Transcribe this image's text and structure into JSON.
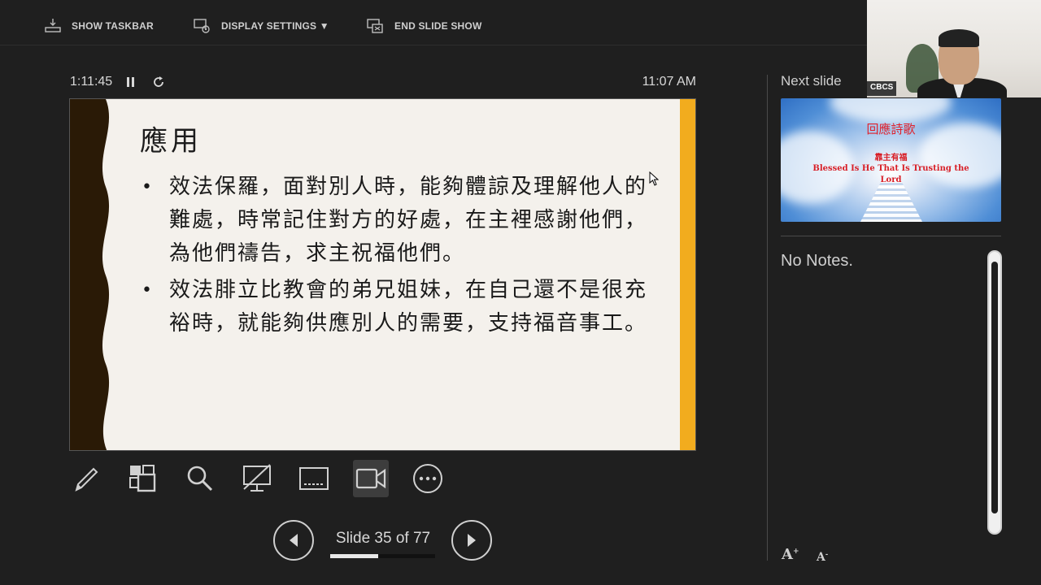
{
  "toolbar": {
    "show_taskbar": "SHOW TASKBAR",
    "display_settings": "DISPLAY SETTINGS ▼",
    "end_slide_show": "END SLIDE SHOW"
  },
  "timer": {
    "elapsed": "1:11:45",
    "clock": "11:07 AM"
  },
  "slide": {
    "title": "應用",
    "bullets": [
      "效法保羅，面對別人時，能夠體諒及理解他人的難處，時常記住對方的好處，在主裡感謝他們，為他們禱告，求主祝福他們。",
      "效法腓立比教會的弟兄姐妹，在自己還不是很充裕時，就能夠供應別人的需要，支持福音事工。"
    ],
    "accent_color": "#f2ac1e",
    "border_color": "#2a1a06"
  },
  "tools": [
    "pen-icon",
    "see-all-slides-icon",
    "zoom-icon",
    "black-screen-icon",
    "subtitles-icon",
    "camera-icon",
    "more-options-icon"
  ],
  "navigation": {
    "slide_count": "Slide 35 of 77",
    "current": 35,
    "total": 77
  },
  "next_slide": {
    "label": "Next slide",
    "title": "回應詩歌",
    "subtitle_cn": "靠主有福",
    "subtitle_en": "Blessed Is He That Is Trusting the Lord"
  },
  "notes": {
    "text": "No Notes."
  },
  "webcam": {
    "label": "CBCS"
  }
}
